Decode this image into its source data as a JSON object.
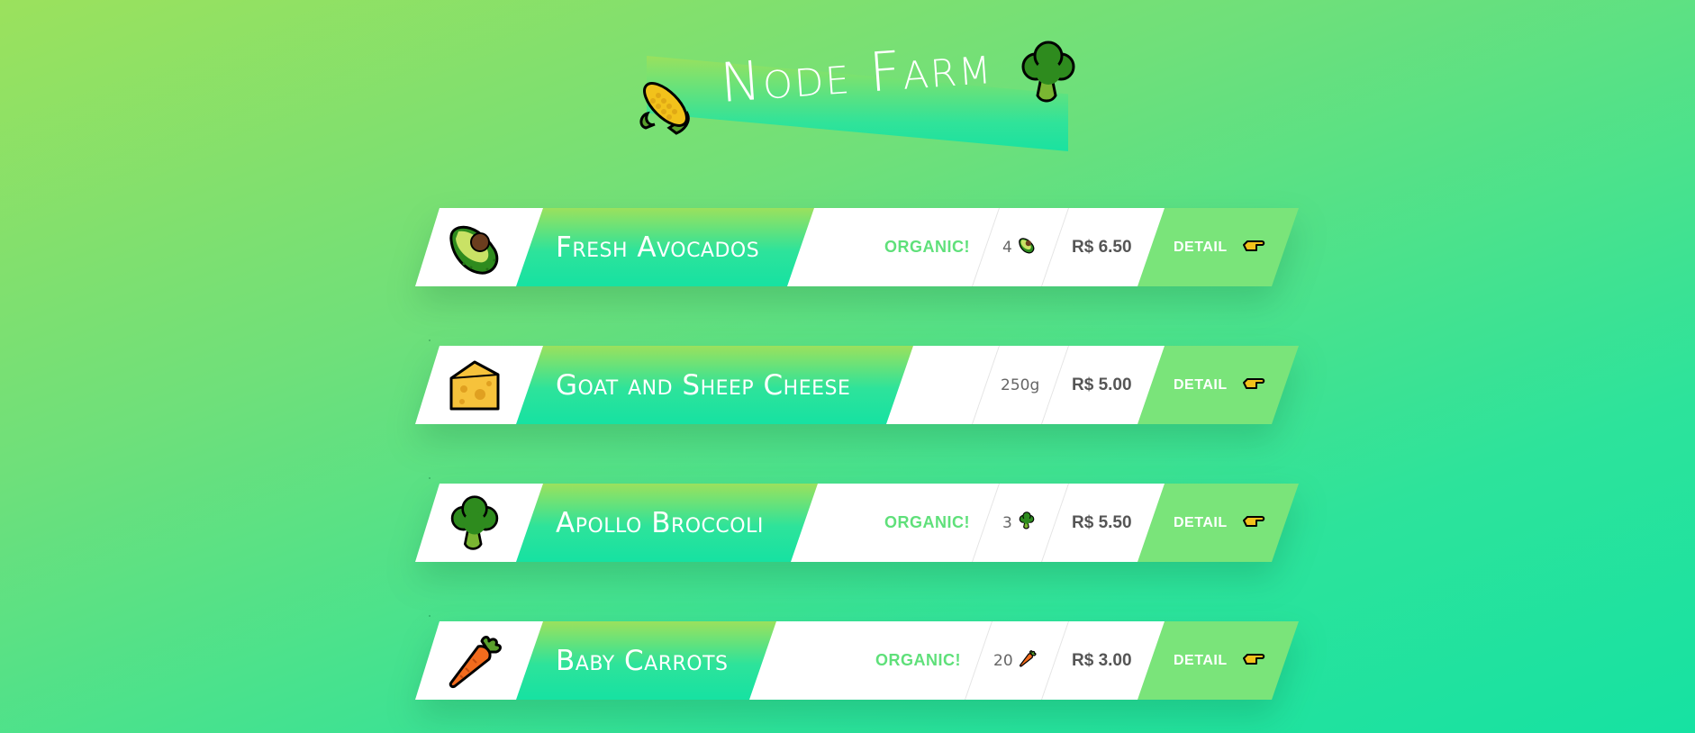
{
  "header": {
    "title": "Node Farm",
    "left_icon": "corn-icon",
    "right_icon": "broccoli-icon"
  },
  "colors": {
    "gradient_start": "#9be15d",
    "gradient_end": "#16e2a2",
    "organic_green": "#5fe07a",
    "detail_green": "#7ae47a"
  },
  "products": [
    {
      "name": "Fresh Avocados",
      "icon": "avocado-icon",
      "organic": "ORGANIC!",
      "quantity": "4",
      "quantity_icon": "avocado-icon",
      "price": "R$ 6.50",
      "detail_label": "DETAIL"
    },
    {
      "name": "Goat and Sheep Cheese",
      "icon": "cheese-icon",
      "organic": "",
      "quantity": "250g",
      "quantity_icon": "",
      "price": "R$ 5.00",
      "detail_label": "DETAIL"
    },
    {
      "name": "Apollo Broccoli",
      "icon": "broccoli-icon",
      "organic": "ORGANIC!",
      "quantity": "3",
      "quantity_icon": "broccoli-icon",
      "price": "R$ 5.50",
      "detail_label": "DETAIL"
    },
    {
      "name": "Baby Carrots",
      "icon": "carrot-icon",
      "organic": "ORGANIC!",
      "quantity": "20",
      "quantity_icon": "carrot-icon",
      "price": "R$ 3.00",
      "detail_label": "DETAIL"
    }
  ]
}
